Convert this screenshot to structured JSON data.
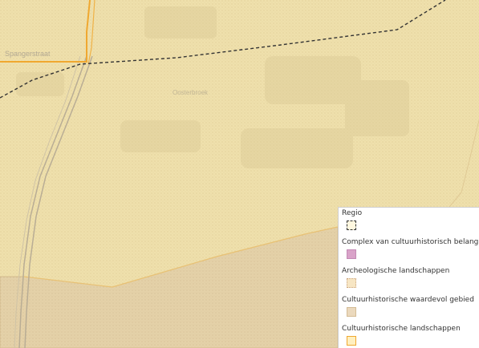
{
  "map": {
    "street_label": "Spangerstraat",
    "place_label": "Oosterbroek"
  },
  "legend": {
    "items": [
      {
        "label": "Regio",
        "symbol": "dashed-outline",
        "color": "#333333"
      },
      {
        "label": "Complex van cultuurhistorisch belang",
        "symbol": "filled-square",
        "color": "#d9a3c9"
      },
      {
        "label": "Archeologische landschappen",
        "symbol": "dotted-square",
        "color": "#f7e6c4"
      },
      {
        "label": "Cultuurhistorische waardevol gebied",
        "symbol": "filled-square",
        "color": "#ebd9bd"
      },
      {
        "label": "Cultuurhistorische landschappen",
        "symbol": "outlined-square",
        "color": "#f0a830"
      }
    ]
  },
  "colors": {
    "basemap": "#efe0ac",
    "waardevol_area": "#e6d3ab",
    "landschap_outline": "#f0a830",
    "regio_line": "#333333"
  }
}
